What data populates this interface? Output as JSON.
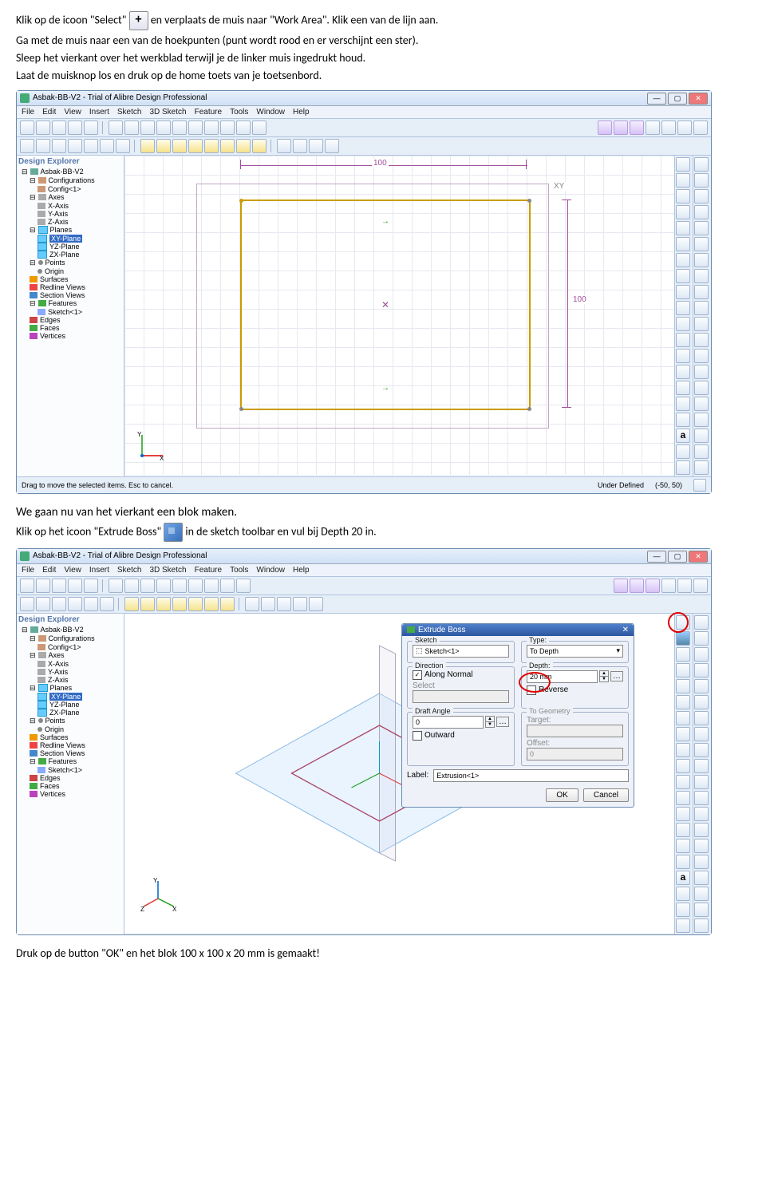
{
  "text": {
    "p1a": "Klik op de icoon \"Select\"",
    "p1b": "en verplaats de muis naar \"Work Area\". Klik een van de lijn aan.",
    "p2": "Ga met de muis naar een van de hoekpunten (punt wordt rood en er verschijnt een ster).",
    "p3": "Sleep het vierkant over het werkblad terwijl je de linker muis ingedrukt houd.",
    "p4": "Laat de muisknop los en druk op de home toets van je toetsenbord.",
    "p5": "We gaan nu van het vierkant een blok maken.",
    "p6a": "Klik op het icoon \"Extrude Boss\"",
    "p6b": "in de sketch toolbar en vul bij Depth 20 in.",
    "p7": "Druk op de button \"OK\" en het blok 100 x 100 x 20 mm is gemaakt!"
  },
  "app": {
    "title": "Asbak-BB-V2 - Trial of Alibre Design Professional",
    "menus": [
      "File",
      "Edit",
      "View",
      "Insert",
      "Sketch",
      "3D Sketch",
      "Feature",
      "Tools",
      "Window",
      "Help"
    ],
    "explorer_title": "Design Explorer",
    "tree": {
      "root": "Asbak-BB-V2",
      "config_group": "Configurations",
      "config_item": "Config<1>",
      "axes_group": "Axes",
      "axes": [
        "X-Axis",
        "Y-Axis",
        "Z-Axis"
      ],
      "planes_group": "Planes",
      "planes": [
        "XY-Plane",
        "YZ-Plane",
        "ZX-Plane"
      ],
      "points_group": "Points",
      "origin": "Origin",
      "surfaces": "Surfaces",
      "redline": "Redline Views",
      "section": "Section Views",
      "features_group": "Features",
      "sketch_item": "Sketch<1>",
      "edges": "Edges",
      "faces": "Faces",
      "vertices": "Vertices"
    },
    "status1": {
      "left": "Drag to move the selected items. Esc to cancel.",
      "mid": "Under Defined",
      "coord": "(-50, 50)"
    },
    "dim_top": "100",
    "dim_right": "100",
    "xy_label": "XY"
  },
  "dialog": {
    "title": "Extrude Boss",
    "sketch_label": "Sketch",
    "sketch_value": "Sketch<1>",
    "type_label": "Type:",
    "type_value": "To Depth",
    "direction_label": "Direction",
    "along_normal": "Along Normal",
    "select_label": "Select",
    "depth_label": "Depth:",
    "depth_value": "20 mm",
    "reverse": "Reverse",
    "draft_label": "Draft Angle",
    "draft_value": "0",
    "outward": "Outward",
    "togeom_label": "To Geometry",
    "target_label": "Target:",
    "offset_label": "Offset:",
    "offset_value": "0",
    "label_label": "Label:",
    "label_value": "Extrusion<1>",
    "ok": "OK",
    "cancel": "Cancel"
  }
}
